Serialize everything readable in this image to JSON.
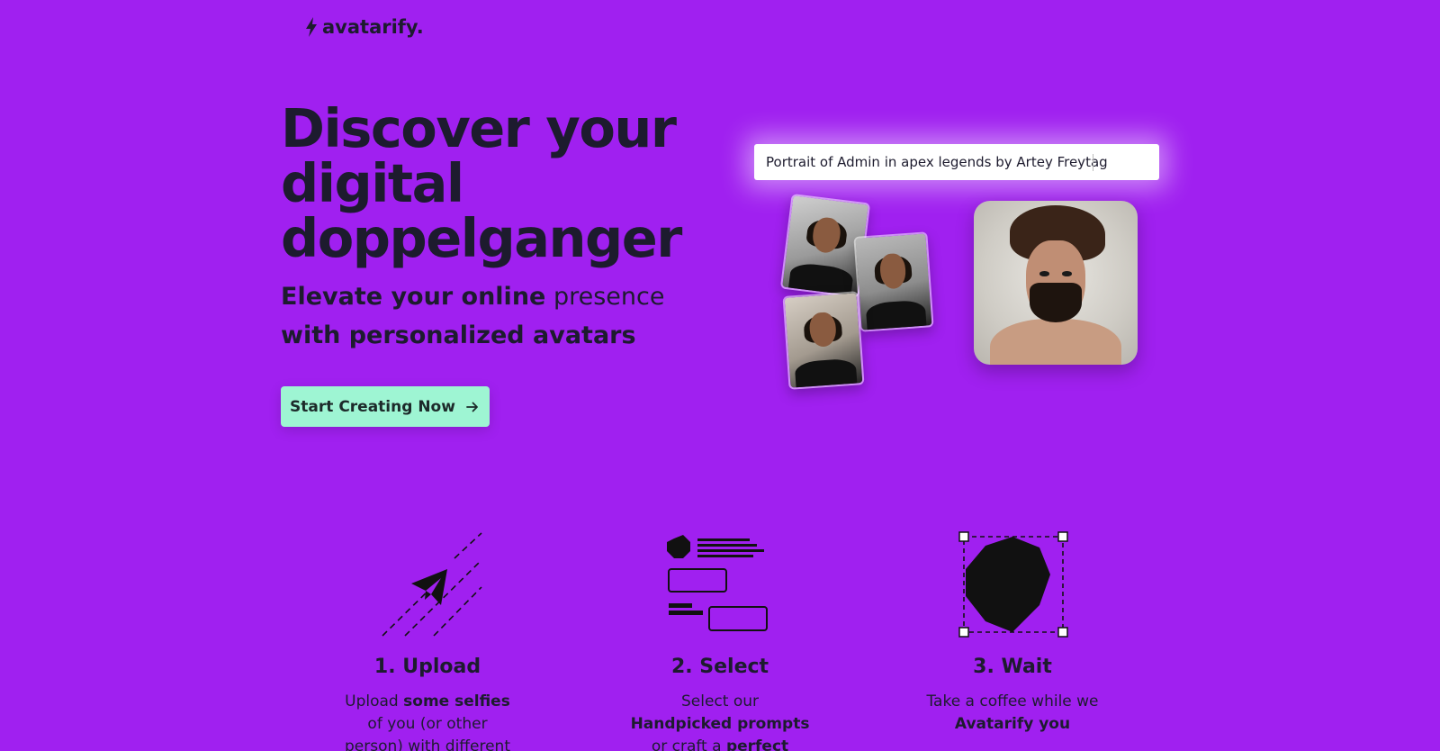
{
  "header": {
    "logo_text": "avatarify.",
    "logo_icon": "lightning-bolt-icon"
  },
  "hero": {
    "title": "Discover your digital doppelganger",
    "subtitle": {
      "part1": "Elevate your online",
      "part2": "presence",
      "part3": "with personalized avatars"
    },
    "cta_label": "Start Creating Now",
    "cta_icon": "arrow-right-icon"
  },
  "prompt_demo": {
    "value": "Portrait of Admin in apex legends by Artey Freytag"
  },
  "steps": [
    {
      "icon": "paper-plane-icon",
      "title": "1. Upload",
      "desc": {
        "pre": "Upload ",
        "bold": "some selfies",
        "post": " of you (or other person) with different angles"
      }
    },
    {
      "icon": "prompt-layout-icon",
      "title": "2. Select",
      "desc": {
        "pre": "Select our ",
        "bold": "Handpicked prompts",
        "mid": " or craft a ",
        "bold2": "perfect prompt!"
      }
    },
    {
      "icon": "octagon-selection-icon",
      "title": "3. Wait",
      "desc": {
        "pre": "Take a coffee while we ",
        "bold": "Avatarify you"
      }
    }
  ],
  "colors": {
    "background": "#a020f0",
    "cta": "#9ef5d3",
    "text": "#1d1b2e"
  }
}
